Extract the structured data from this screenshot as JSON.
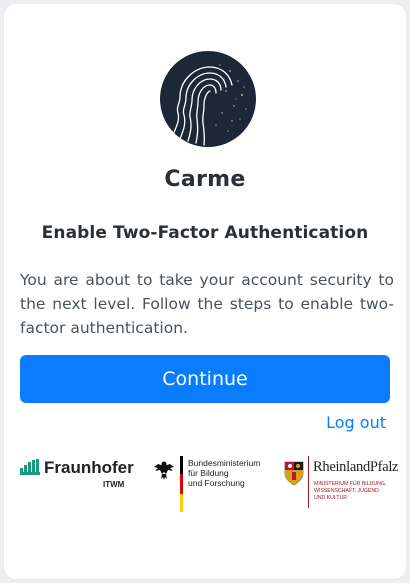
{
  "app": {
    "name": "Carme"
  },
  "heading": "Enable Two-Factor Authentication",
  "description": "You are about to take your account security to the next level. Follow the steps to enable two-factor authentication.",
  "actions": {
    "continue_label": "Continue",
    "logout_label": "Log out"
  },
  "partners": {
    "fraunhofer": {
      "name": "Fraunhofer",
      "sub": "ITWM"
    },
    "bmbf": {
      "lines": [
        "Bundesministerium",
        "für Bildung",
        "und Forschung"
      ]
    },
    "rlp": {
      "name": "RheinlandPfalz",
      "sub_lines": [
        "MINISTERIUM FÜR BILDUNG,",
        "WISSENSCHAFT, JUGEND",
        "UND KULTUR"
      ]
    }
  },
  "colors": {
    "primary": "#0a7cff",
    "text_dark": "#2b2f36",
    "text_body": "#4a5260",
    "logo_bg": "#1c2838",
    "fraunhofer_green": "#179c7d",
    "rlp_red": "#a01923"
  },
  "icons": {
    "app_logo": "head-silhouette-logo",
    "fraunhofer_logo": "fraunhofer-logo",
    "bmbf_logo": "federal-eagle-logo",
    "rlp_logo": "rlp-coat-of-arms-logo"
  }
}
